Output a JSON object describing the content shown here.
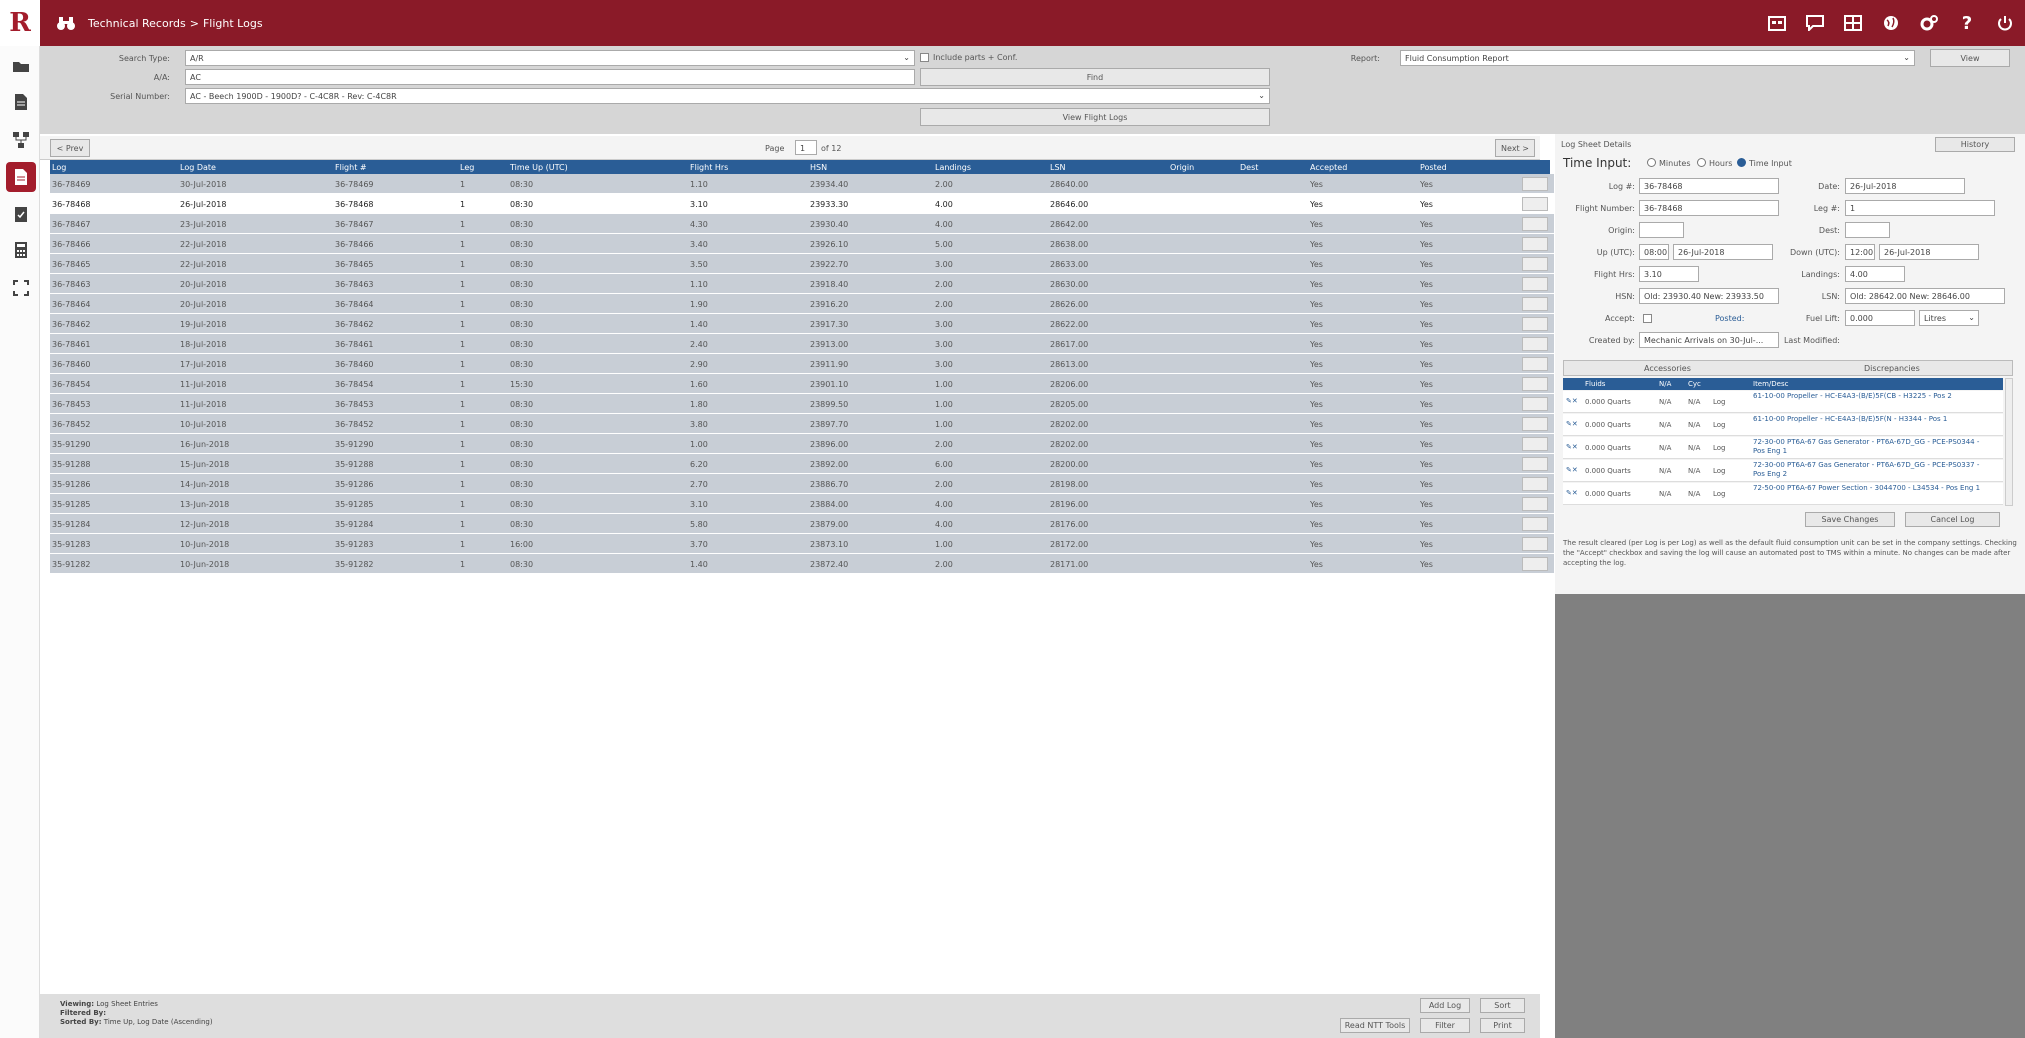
{
  "app": {
    "logo": "R",
    "breadcrumb": [
      "Technical Records",
      "Flight Logs"
    ],
    "breadcrumb_sep": ">"
  },
  "topicons": [
    "calendar-icon",
    "chat-icon",
    "grid-icon",
    "globe-icon",
    "settings-icon",
    "help-icon",
    "power-icon"
  ],
  "sidebar": [
    "folder-icon",
    "document-icon",
    "hierarchy-icon",
    "log-icon",
    "checklist-icon",
    "calculator-icon",
    "expand-icon"
  ],
  "search": {
    "type_label": "Search Type:",
    "type_value": "A/R",
    "include_label": "Include parts + Conf.",
    "ac_label": "A/A:",
    "ac_value": "AC",
    "serial_label": "Serial Number:",
    "serial_value": "AC - Beech 1900D - 1900D? - C-4C8R - Rev: C-4C8R",
    "find_btn": "Find",
    "view_btn": "View Flight Logs",
    "report_label": "Report:",
    "report_value": "Fluid Consumption Report",
    "view_report_btn": "View"
  },
  "pager": {
    "prev": "< Prev",
    "page_label": "Page",
    "page_value": "1",
    "page_of": "of 12",
    "next": "Next >"
  },
  "table": {
    "columns": [
      "Log",
      "Log Date",
      "Flight #",
      "Leg",
      "Time Up (UTC)",
      "Flight Hrs",
      "HSN",
      "Landings",
      "LSN",
      "Origin",
      "Dest",
      "Accepted",
      "Posted"
    ],
    "rows": [
      [
        "36-78469",
        "30-Jul-2018",
        "36-78469",
        "1",
        "08:30",
        "1.10",
        "23934.40",
        "2.00",
        "28640.00",
        "",
        "",
        "Yes",
        "Yes"
      ],
      [
        "36-78468",
        "26-Jul-2018",
        "36-78468",
        "1",
        "08:30",
        "3.10",
        "23933.30",
        "4.00",
        "28646.00",
        "",
        "",
        "Yes",
        "Yes"
      ],
      [
        "36-78467",
        "23-Jul-2018",
        "36-78467",
        "1",
        "08:30",
        "4.30",
        "23930.40",
        "4.00",
        "28642.00",
        "",
        "",
        "Yes",
        "Yes"
      ],
      [
        "36-78466",
        "22-Jul-2018",
        "36-78466",
        "1",
        "08:30",
        "3.40",
        "23926.10",
        "5.00",
        "28638.00",
        "",
        "",
        "Yes",
        "Yes"
      ],
      [
        "36-78465",
        "22-Jul-2018",
        "36-78465",
        "1",
        "08:30",
        "3.50",
        "23922.70",
        "3.00",
        "28633.00",
        "",
        "",
        "Yes",
        "Yes"
      ],
      [
        "36-78463",
        "20-Jul-2018",
        "36-78463",
        "1",
        "08:30",
        "1.10",
        "23918.40",
        "2.00",
        "28630.00",
        "",
        "",
        "Yes",
        "Yes"
      ],
      [
        "36-78464",
        "20-Jul-2018",
        "36-78464",
        "1",
        "08:30",
        "1.90",
        "23916.20",
        "2.00",
        "28626.00",
        "",
        "",
        "Yes",
        "Yes"
      ],
      [
        "36-78462",
        "19-Jul-2018",
        "36-78462",
        "1",
        "08:30",
        "1.40",
        "23917.30",
        "3.00",
        "28622.00",
        "",
        "",
        "Yes",
        "Yes"
      ],
      [
        "36-78461",
        "18-Jul-2018",
        "36-78461",
        "1",
        "08:30",
        "2.40",
        "23913.00",
        "3.00",
        "28617.00",
        "",
        "",
        "Yes",
        "Yes"
      ],
      [
        "36-78460",
        "17-Jul-2018",
        "36-78460",
        "1",
        "08:30",
        "2.90",
        "23911.90",
        "3.00",
        "28613.00",
        "",
        "",
        "Yes",
        "Yes"
      ],
      [
        "36-78454",
        "11-Jul-2018",
        "36-78454",
        "1",
        "15:30",
        "1.60",
        "23901.10",
        "1.00",
        "28206.00",
        "",
        "",
        "Yes",
        "Yes"
      ],
      [
        "36-78453",
        "11-Jul-2018",
        "36-78453",
        "1",
        "08:30",
        "1.80",
        "23899.50",
        "1.00",
        "28205.00",
        "",
        "",
        "Yes",
        "Yes"
      ],
      [
        "36-78452",
        "10-Jul-2018",
        "36-78452",
        "1",
        "08:30",
        "3.80",
        "23897.70",
        "1.00",
        "28202.00",
        "",
        "",
        "Yes",
        "Yes"
      ],
      [
        "35-91290",
        "16-Jun-2018",
        "35-91290",
        "1",
        "08:30",
        "1.00",
        "23896.00",
        "2.00",
        "28202.00",
        "",
        "",
        "Yes",
        "Yes"
      ],
      [
        "35-91288",
        "15-Jun-2018",
        "35-91288",
        "1",
        "08:30",
        "6.20",
        "23892.00",
        "6.00",
        "28200.00",
        "",
        "",
        "Yes",
        "Yes"
      ],
      [
        "35-91286",
        "14-Jun-2018",
        "35-91286",
        "1",
        "08:30",
        "2.70",
        "23886.70",
        "2.00",
        "28198.00",
        "",
        "",
        "Yes",
        "Yes"
      ],
      [
        "35-91285",
        "13-Jun-2018",
        "35-91285",
        "1",
        "08:30",
        "3.10",
        "23884.00",
        "4.00",
        "28196.00",
        "",
        "",
        "Yes",
        "Yes"
      ],
      [
        "35-91284",
        "12-Jun-2018",
        "35-91284",
        "1",
        "08:30",
        "5.80",
        "23879.00",
        "4.00",
        "28176.00",
        "",
        "",
        "Yes",
        "Yes"
      ],
      [
        "35-91283",
        "10-Jun-2018",
        "35-91283",
        "1",
        "16:00",
        "3.70",
        "23873.10",
        "1.00",
        "28172.00",
        "",
        "",
        "Yes",
        "Yes"
      ],
      [
        "35-91282",
        "10-Jun-2018",
        "35-91282",
        "1",
        "08:30",
        "1.40",
        "23872.40",
        "2.00",
        "28171.00",
        "",
        "",
        "Yes",
        "Yes"
      ]
    ]
  },
  "footer": {
    "viewing_label": "Viewing:",
    "viewing_value": "Log Sheet Entries",
    "filtered_label": "Filtered By:",
    "filtered_value": "",
    "sorted_label": "Sorted By:",
    "sorted_value": "Time Up, Log Date (Ascending)",
    "add_btn": "Add Log",
    "sort_btn": "Sort",
    "read_btn": "Read NTT Tools",
    "filter_btn": "Filter",
    "print_btn": "Print"
  },
  "details": {
    "title": "Log Sheet Details",
    "history_btn": "History",
    "time_input_label": "Time Input:",
    "ti_options": [
      "Minutes",
      "Hours",
      "Time Input"
    ],
    "log_no_label": "Log #:",
    "log_no": "36-78468",
    "date_label": "Date:",
    "date": "26-Jul-2018",
    "flight_label": "Flight Number:",
    "flight": "36-78468",
    "leg_label": "Leg #:",
    "leg": "1",
    "origin_label": "Origin:",
    "dest_label": "Dest:",
    "up_label": "Up (UTC):",
    "up_time": "08:00",
    "up_date": "26-Jul-2018",
    "down_label": "Down (UTC):",
    "down_time": "12:00",
    "down_date": "26-Jul-2018",
    "hrs_label": "Flight Hrs:",
    "hrs": "3.10",
    "landings_label": "Landings:",
    "landings": "4.00",
    "hsn_label": "HSN:",
    "hsn": "Old: 23930.40 New: 23933.50",
    "lsn_label": "LSN:",
    "lsn": "Old: 28642.00 New: 28646.00",
    "accept_label": "Accept:",
    "posted_label": "Posted:",
    "fuel_label": "Fuel Lift:",
    "fuel": "0.000",
    "fuel_unit": "Litres",
    "created_label": "Created by:",
    "created": "Mechanic Arrivals on 30-Jul-...",
    "modified_label": "Last Modified:",
    "tabs": [
      "Accessories",
      "Discrepancies"
    ],
    "acc_cols": [
      "Fluids",
      "N/A",
      "Cyc",
      "Item/Desc"
    ],
    "acc_rows": [
      [
        "0.000 Quarts",
        "N/A",
        "N/A",
        "61-10-00 Propeller - HC-E4A3-(B/E)5F(CB - H3225 - Pos 2"
      ],
      [
        "0.000 Quarts",
        "N/A",
        "N/A",
        "61-10-00 Propeller - HC-E4A3-(B/E)5F(N - H3344 - Pos 1"
      ],
      [
        "0.000 Quarts",
        "N/A",
        "N/A",
        "72-30-00 PT6A-67 Gas Generator - PT6A-67D_GG - PCE-PS0344 - Pos Eng 1"
      ],
      [
        "0.000 Quarts",
        "N/A",
        "N/A",
        "72-30-00 PT6A-67 Gas Generator - PT6A-67D_GG - PCE-PS0337 - Pos Eng 2"
      ],
      [
        "0.000 Quarts",
        "N/A",
        "N/A",
        "72-50-00 PT6A-67 Power Section - 3044700 - L34534 - Pos Eng 1"
      ]
    ],
    "save_btn": "Save Changes",
    "cancel_btn": "Cancel Log",
    "note": "The result cleared (per Log is per Log) as well as the default fluid consumption unit can be set in the company settings. Checking the \"Accept\" checkbox and saving the log will cause an automated post to TMS within a minute. No changes can be made after accepting the log."
  }
}
